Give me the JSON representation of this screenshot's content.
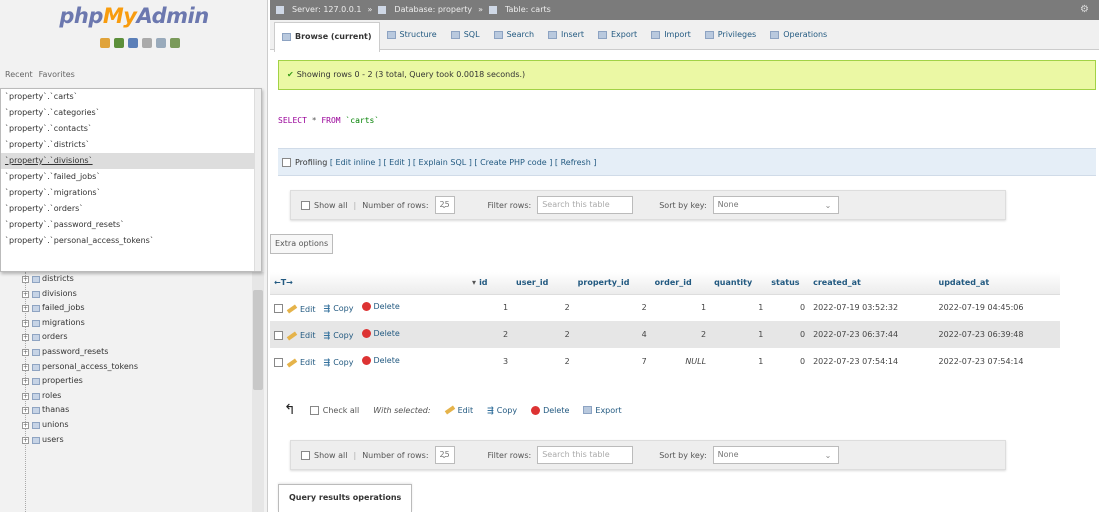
{
  "sidebar": {
    "logo": {
      "php": "php",
      "my": "My",
      "admin": "Admin"
    },
    "tabs": [
      "Recent",
      "Favorites"
    ],
    "recent_items": [
      "`property`.`carts`",
      "`property`.`categories`",
      "`property`.`contacts`",
      "`property`.`districts`",
      "`property`.`divisions`",
      "`property`.`failed_jobs`",
      "`property`.`migrations`",
      "`property`.`orders`",
      "`property`.`password_resets`",
      "`property`.`personal_access_tokens`"
    ],
    "tree_items": [
      "districts",
      "divisions",
      "failed_jobs",
      "migrations",
      "orders",
      "password_resets",
      "personal_access_tokens",
      "properties",
      "roles",
      "thanas",
      "unions",
      "users"
    ]
  },
  "breadcrumb": [
    "Server: 127.0.0.1",
    "Database: property",
    "Table: carts"
  ],
  "tabs": [
    "Browse (current)",
    "Structure",
    "SQL",
    "Search",
    "Insert",
    "Export",
    "Import",
    "Privileges",
    "Operations"
  ],
  "success_message": "Showing rows 0 - 2 (3 total, Query took 0.0018 seconds.)",
  "sql": {
    "select": "SELECT",
    "star": " * ",
    "from": "FROM",
    "table": " `carts`"
  },
  "profiling": {
    "label": "Profiling",
    "links": "[ Edit inline ] [ Edit ] [ Explain SQL ] [ Create PHP code ] [ Refresh ]"
  },
  "nav": {
    "show_all": "Show all",
    "number_of_rows_label": "Number of rows:",
    "number_of_rows": "25",
    "filter_label": "Filter rows:",
    "filter_placeholder": "Search this table",
    "sort_label": "Sort by key:",
    "sort_value": "None"
  },
  "extra_options": "Extra options",
  "table": {
    "columns": [
      "id",
      "user_id",
      "property_id",
      "order_id",
      "quantity",
      "status",
      "created_at",
      "updated_at"
    ],
    "actions": {
      "edit": "Edit",
      "copy": "Copy",
      "delete": "Delete"
    },
    "rows": [
      [
        "1",
        "2",
        "2",
        "1",
        "1",
        "0",
        "2022-07-19 03:52:32",
        "2022-07-19 04:45:06"
      ],
      [
        "2",
        "2",
        "4",
        "2",
        "1",
        "0",
        "2022-07-23 06:37:44",
        "2022-07-23 06:39:48"
      ],
      [
        "3",
        "2",
        "7",
        "NULL",
        "1",
        "0",
        "2022-07-23 07:54:14",
        "2022-07-23 07:54:14"
      ]
    ]
  },
  "with_selected": {
    "check_all": "Check all",
    "with_selected_label": "With selected:",
    "edit": "Edit",
    "copy": "Copy",
    "delete": "Delete",
    "export": "Export"
  },
  "query_results_operations": "Query results operations",
  "colors": {
    "link": "#235a81",
    "success_bg": "#ebf8a4",
    "breadcrumb_bg": "#7b7b7b"
  }
}
